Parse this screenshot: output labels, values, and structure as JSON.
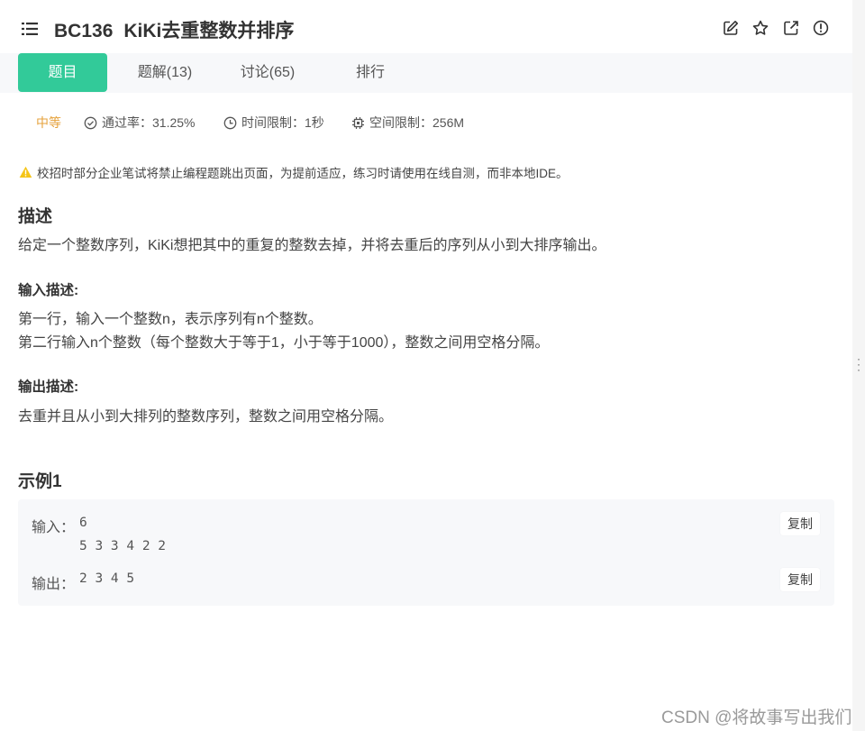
{
  "header": {
    "code": "BC136",
    "title": "KiKi去重整数并排序"
  },
  "tabs": [
    {
      "label": "题目",
      "active": true
    },
    {
      "label": "题解(13)",
      "active": false
    },
    {
      "label": "讨论(65)",
      "active": false
    },
    {
      "label": "排行",
      "active": false
    }
  ],
  "meta": {
    "difficulty": "中等",
    "pass_rate": "通过率：31.25%",
    "time_limit": "时间限制：1秒",
    "memory_limit": "空间限制：256M"
  },
  "notice": "校招时部分企业笔试将禁止编程题跳出页面，为提前适应，练习时请使用在线自测，而非本地IDE。",
  "description": {
    "heading": "描述",
    "text": "给定一个整数序列，KiKi想把其中的重复的整数去掉，并将去重后的序列从小到大排序输出。"
  },
  "input_desc": {
    "heading": "输入描述:",
    "line1": "第一行，输入一个整数n，表示序列有n个整数。",
    "line2": "第二行输入n个整数（每个整数大于等于1，小于等于1000），整数之间用空格分隔。"
  },
  "output_desc": {
    "heading": "输出描述:",
    "text": "去重并且从小到大排列的整数序列，整数之间用空格分隔。"
  },
  "example": {
    "heading": "示例1",
    "input_label": "输入：",
    "input_line1": "6",
    "input_line2": "5 3 3 4 2 2",
    "output_label": "输出：",
    "output_value": "2 3 4 5",
    "copy_label": "复制"
  },
  "watermark": "CSDN @将故事写出我们",
  "colors": {
    "accent": "#32ca99",
    "difficulty": "#e6a23c",
    "warning": "#f5c518"
  },
  "icons": {
    "menu": "list-icon",
    "edit": "edit-icon",
    "star": "star-icon",
    "share": "external-link-icon",
    "report": "alert-circle-icon"
  }
}
